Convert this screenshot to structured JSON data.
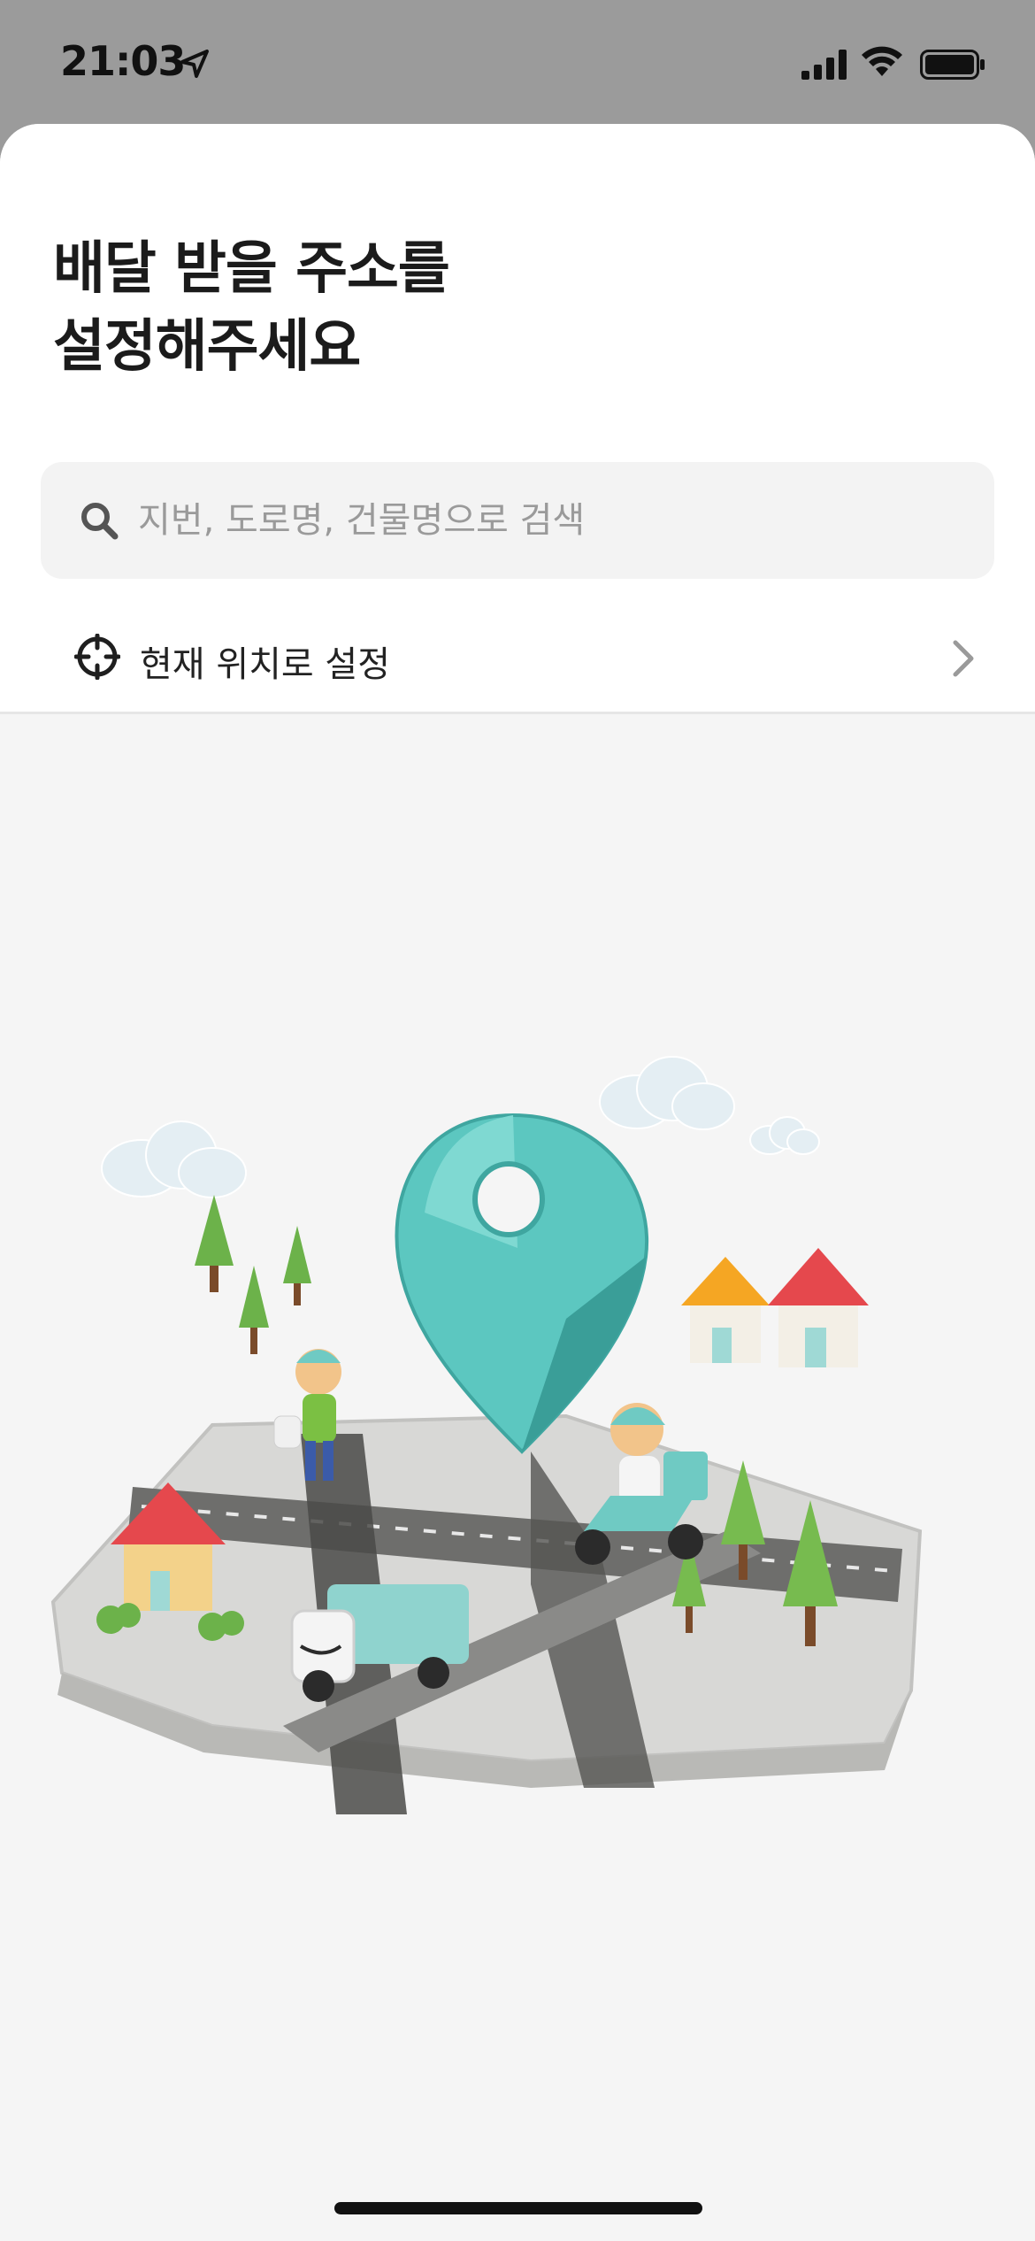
{
  "status_bar": {
    "time": "21:03"
  },
  "header": {
    "title_line1": "배달 받을 주소를",
    "title_line2": "설정해주세요"
  },
  "search": {
    "placeholder": "지번, 도로명, 건물명으로 검색",
    "value": ""
  },
  "current_location": {
    "label": "현재 위치로 설정"
  },
  "colors": {
    "pin": "#5cc7c0",
    "background": "#f5f5f5",
    "sheet": "#ffffff",
    "status_bar": "#9b9b9b"
  },
  "icons": {
    "search": "search-icon",
    "current_location": "crosshair-icon",
    "chevron": "chevron-right-icon"
  }
}
